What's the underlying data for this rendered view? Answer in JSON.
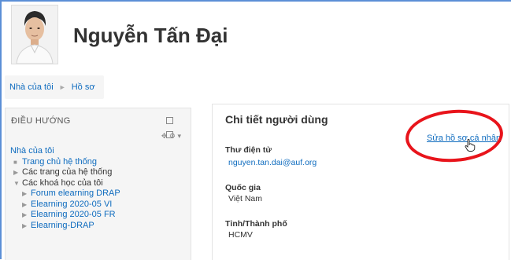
{
  "profile": {
    "name": "Nguyễn Tấn Đại"
  },
  "breadcrumb": {
    "home": "Nhà của tôi",
    "current": "Hồ sơ",
    "separator": "►"
  },
  "navigation": {
    "title": "ĐIỀU HƯỚNG",
    "items": [
      {
        "label": "Nhà của tôi",
        "marker": ""
      },
      {
        "label": "Trang chủ hệ thống",
        "marker": "■"
      },
      {
        "label": "Các trang của hệ thống",
        "marker": "▶"
      },
      {
        "label": "Các khoá học của tôi",
        "marker": "▼"
      }
    ],
    "courses": [
      {
        "label": "Forum elearning DRAP",
        "marker": "▶"
      },
      {
        "label": "Elearning 2020-05 VI",
        "marker": "▶"
      },
      {
        "label": "Elearning 2020-05 FR",
        "marker": "▶"
      },
      {
        "label": "Elearning-DRAP",
        "marker": "▶"
      }
    ]
  },
  "user_details": {
    "title": "Chi tiết người dùng",
    "edit_link": "Sửa hồ sơ cá nhân",
    "email_label": "Thư điện tử",
    "email_value": "nguyen.tan.dai@auf.org",
    "country_label": "Quốc gia",
    "country_value": "Việt Nam",
    "city_label": "Tỉnh/Thành phố",
    "city_value": "HCMV"
  },
  "colors": {
    "link": "#0f6cbf",
    "annotation": "#e8141b",
    "window_frame": "#5b8fd6"
  }
}
